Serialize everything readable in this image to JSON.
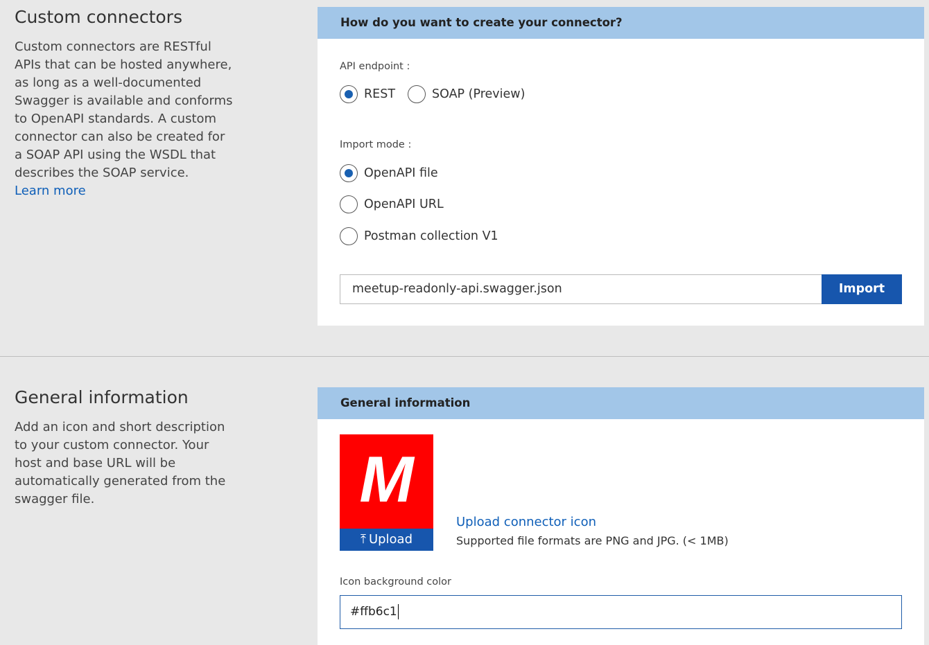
{
  "custom_connectors": {
    "title": "Custom connectors",
    "description": "Custom connectors are RESTful APIs that can be hosted anywhere, as long as a well-documented Swagger is available and conforms to OpenAPI standards. A custom connector can also be created for a SOAP API using the WSDL that describes the SOAP service.",
    "learn_more": "Learn more"
  },
  "create_card": {
    "header": "How do you want to create your connector?",
    "api_endpoint_label": "API endpoint :",
    "api_endpoint_options": [
      "REST",
      "SOAP (Preview)"
    ],
    "api_endpoint_selected": "REST",
    "import_mode_label": "Import mode :",
    "import_mode_options": [
      "OpenAPI file",
      "OpenAPI URL",
      "Postman collection V1"
    ],
    "import_mode_selected": "OpenAPI file",
    "file_value": "meetup-readonly-api.swagger.json",
    "import_button": "Import"
  },
  "general_information": {
    "title": "General information",
    "description": "Add an icon and short description to your custom connector. Your host and base URL will be automatically generated from the swagger file."
  },
  "general_card": {
    "header": "General information",
    "icon_letter": "M",
    "icon_color": "#ff0000",
    "upload_button": "Upload",
    "upload_icon": "upload-arrow-icon",
    "upload_link": "Upload connector icon",
    "upload_note": "Supported file formats are PNG and JPG. (< 1MB)",
    "bg_color_label": "Icon background color",
    "bg_color_value": "#ffb6c1"
  },
  "colors": {
    "accent": "#1756ad",
    "header_bg": "#a2c6e8",
    "link": "#0f5fb8",
    "page_bg": "#e8e8e8"
  }
}
